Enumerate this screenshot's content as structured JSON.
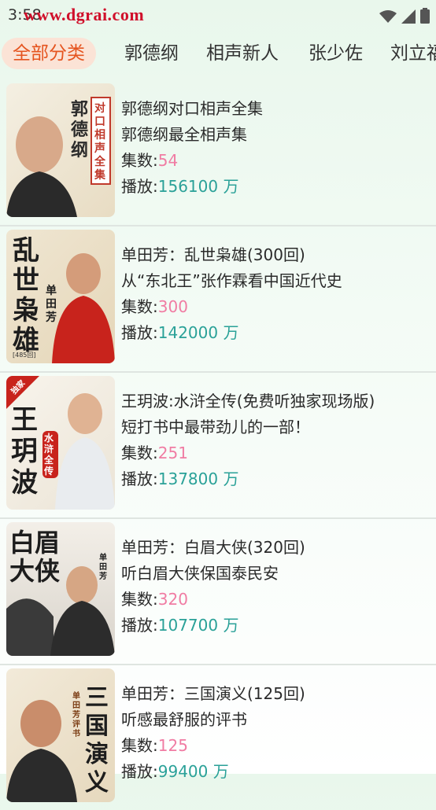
{
  "status": {
    "time": "3:58",
    "watermark": "www.dgrai.com"
  },
  "tabs": [
    {
      "label": "全部分类",
      "active": true
    },
    {
      "label": "郭德纲",
      "active": false
    },
    {
      "label": "相声新人",
      "active": false
    },
    {
      "label": "张少佐",
      "active": false
    },
    {
      "label": "刘立福",
      "active": false
    }
  ],
  "labels": {
    "episodes": "集数:",
    "plays": "播放:",
    "unit": " 万"
  },
  "items": [
    {
      "title": "郭德纲对口相声全集",
      "subtitle": "郭德纲最全相声集",
      "episodes": "54",
      "plays": "156100",
      "cover_text": [
        "郭德纲",
        "对口相声全集"
      ]
    },
    {
      "title": "单田芳：乱世枭雄(300回)",
      "subtitle": "从“东北王”张作霖看中国近代史",
      "episodes": "300",
      "plays": "142000",
      "cover_text": [
        "乱世枭雄",
        "单田芳",
        "[485回]"
      ]
    },
    {
      "title": "王玥波:水浒全传(免费听独家现场版)",
      "subtitle": "短打书中最带劲儿的一部！",
      "episodes": "251",
      "plays": "137800",
      "cover_text": [
        "王玥波",
        "水浒全传",
        "独家"
      ]
    },
    {
      "title": "单田芳：白眉大侠(320回)",
      "subtitle": "听白眉大侠保国泰民安",
      "episodes": "320",
      "plays": "107700",
      "cover_text": [
        "白眉大侠",
        "单田芳"
      ]
    },
    {
      "title": "单田芳：三国演义(125回)",
      "subtitle": "听感最舒服的评书",
      "episodes": "125",
      "plays": "99400",
      "cover_text": [
        "三国演义",
        "单田芳评书"
      ]
    }
  ]
}
